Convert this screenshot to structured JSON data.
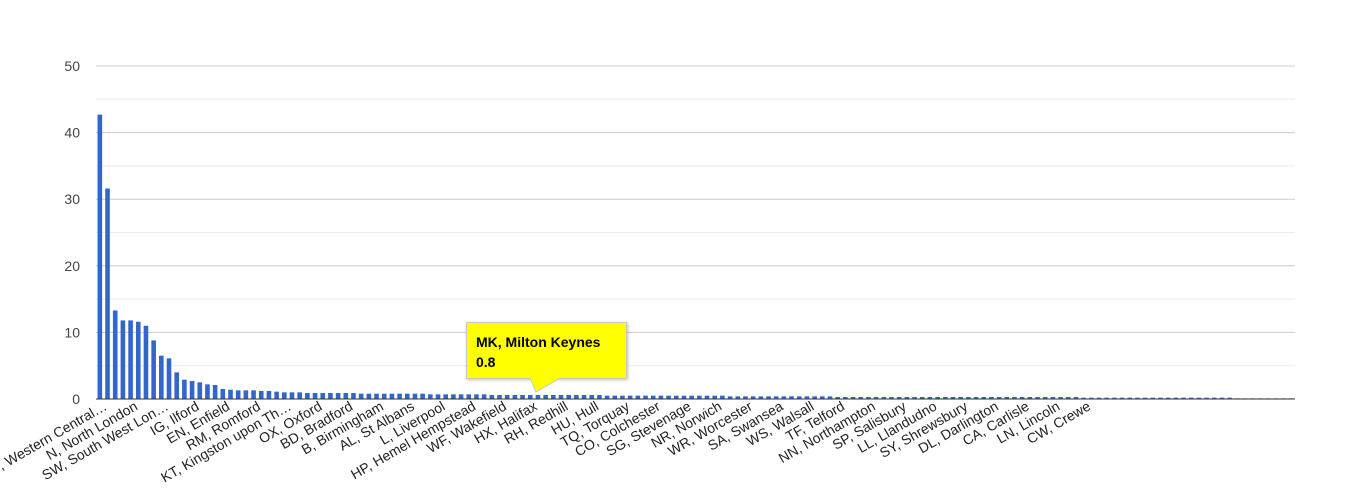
{
  "chart_data": {
    "type": "bar",
    "yticks": [
      "0",
      "10",
      "20",
      "30",
      "40",
      "50"
    ],
    "ylim": [
      0,
      50
    ],
    "grid": true,
    "color": "#3366cc",
    "tooltip": {
      "title": "MK, Milton Keynes",
      "value": "0.8",
      "index": 36
    },
    "labels": [
      "WC, Western Central…",
      "N, North London",
      "SW, South West Lon…",
      "IG, Ilford",
      "EN, Enfield",
      "RM, Romford",
      "KT, Kingston upon Th…",
      "OX, Oxford",
      "BD, Bradford",
      "B, Birmingham",
      "AL, St Albans",
      "L, Liverpool",
      "HP, Hemel Hempstead",
      "WF, Wakefield",
      "HX, Halifax",
      "RH, Redhill",
      "HU, Hull",
      "TQ, Torquay",
      "CO, Colchester",
      "SG, Stevenage",
      "NR, Norwich",
      "WR, Worcester",
      "SA, Swansea",
      "WS, Walsall",
      "TF, Telford",
      "NN, Northampton",
      "SP, Salisbury",
      "LL, Llandudno",
      "SY, Shrewsbury",
      "DL, Darlington",
      "CA, Carlisle",
      "LN, Lincoln",
      "CW, Crewe"
    ],
    "values": [
      42.7,
      31.6,
      13.3,
      11.8,
      11.8,
      11.6,
      11.0,
      8.8,
      6.5,
      6.1,
      4.0,
      2.9,
      2.7,
      2.5,
      2.2,
      2.1,
      1.5,
      1.4,
      1.3,
      1.3,
      1.3,
      1.2,
      1.2,
      1.1,
      1.0,
      1.0,
      1.0,
      0.9,
      0.9,
      0.9,
      0.9,
      0.9,
      0.9,
      0.9,
      0.8,
      0.8,
      0.8,
      0.8,
      0.8,
      0.8,
      0.8,
      0.8,
      0.8,
      0.7,
      0.7,
      0.7,
      0.7,
      0.7,
      0.7,
      0.7,
      0.7,
      0.6,
      0.6,
      0.6,
      0.6,
      0.6,
      0.6,
      0.6,
      0.6,
      0.6,
      0.6,
      0.6,
      0.6,
      0.6,
      0.6,
      0.6,
      0.5,
      0.5,
      0.5,
      0.5,
      0.5,
      0.5,
      0.5,
      0.5,
      0.5,
      0.5,
      0.5,
      0.5,
      0.5,
      0.5,
      0.5,
      0.5,
      0.4,
      0.4,
      0.4,
      0.4,
      0.4,
      0.4,
      0.4,
      0.4,
      0.4,
      0.4,
      0.4,
      0.4,
      0.4,
      0.4,
      0.3,
      0.3,
      0.3,
      0.3,
      0.3,
      0.3,
      0.3,
      0.3,
      0.3,
      0.3,
      0.3,
      0.3,
      0.3,
      0.3,
      0.3,
      0.3,
      0.3,
      0.3,
      0.3,
      0.3,
      0.3,
      0.3,
      0.3,
      0.3,
      0.3,
      0.3,
      0.3,
      0.3,
      0.3,
      0.3,
      0.3,
      0.3,
      0.2,
      0.2,
      0.2,
      0.2,
      0.2,
      0.2,
      0.2,
      0.2,
      0.2,
      0.2,
      0.2,
      0.2,
      0.2,
      0.2,
      0.2,
      0.2,
      0.2,
      0.2,
      0.2,
      0.2,
      0.1,
      0.1,
      0.1,
      0.1,
      0.1,
      0.1,
      0.1,
      0.1
    ]
  }
}
